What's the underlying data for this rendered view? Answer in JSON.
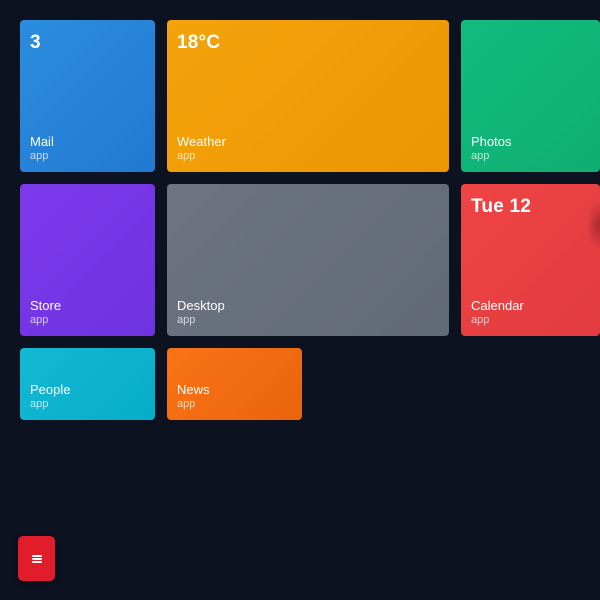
{
  "tiles": [
    {
      "id": "mail",
      "name": "Mail",
      "subtitle": "app",
      "badge": "3",
      "color": "#2784d9"
    },
    {
      "id": "weather",
      "name": "Weather",
      "subtitle": "app",
      "badge": "18°C",
      "color": "#f29d08"
    },
    {
      "id": "photos",
      "name": "Photos",
      "subtitle": "app",
      "badge": "",
      "color": "#10b679"
    },
    {
      "id": "store",
      "name": "Store",
      "subtitle": "app",
      "badge": "",
      "color": "#7537e8"
    },
    {
      "id": "desktop",
      "name": "Desktop",
      "subtitle": "app",
      "badge": "",
      "color": "#686f7c"
    },
    {
      "id": "calendar",
      "name": "Calendar",
      "subtitle": "app",
      "badge": "Tue 12",
      "color": "#e94042"
    },
    {
      "id": "people",
      "name": "People",
      "subtitle": "app",
      "badge": "",
      "color": "#0db3cf"
    },
    {
      "id": "news",
      "name": "News",
      "subtitle": "app",
      "badge": "",
      "color": "#f26c11"
    }
  ],
  "start_button": {
    "icon": "hamburger-menu-icon",
    "color": "#e11d2c"
  },
  "background_color": "#0c1220"
}
